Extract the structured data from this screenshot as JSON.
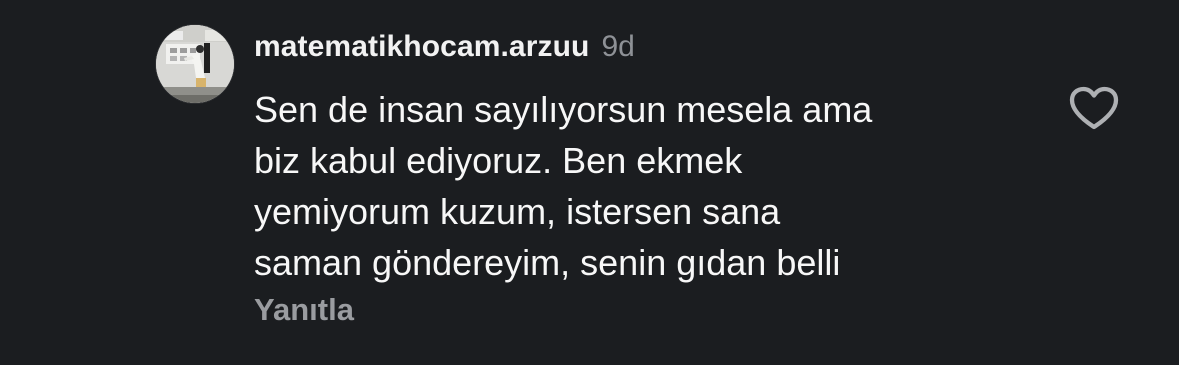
{
  "comment": {
    "username": "matematikhocam.arzuu",
    "time": "9d",
    "text": "Sen de insan sayılıyorsun mesela ama\nbiz kabul ediyoruz. Ben ekmek\nyemiyorum kuzum, istersen sana\nsaman göndereyim, senin gıdan belli",
    "reply_label": "Yanıtla"
  },
  "icons": {
    "avatar": "avatar-photo",
    "like": "heart-outline-icon"
  }
}
